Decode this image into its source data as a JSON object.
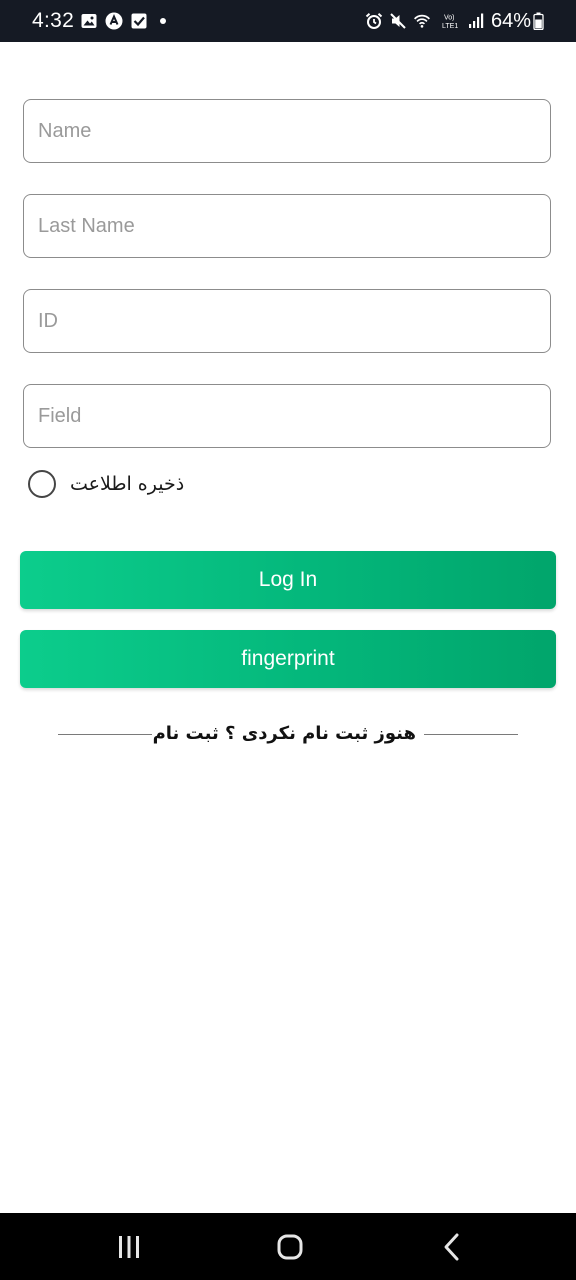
{
  "status_bar": {
    "time": "4:32",
    "battery": "64%",
    "icons": [
      "image-icon",
      "a-badge-icon",
      "checkbox-icon",
      "alarm-icon",
      "mute-icon",
      "wifi-icon",
      "volte-icon",
      "signal-icon",
      "battery-icon"
    ]
  },
  "form": {
    "name_placeholder": "Name",
    "last_name_placeholder": "Last Name",
    "id_placeholder": "ID",
    "field_placeholder": "Field",
    "remember_label": "ذخیره اطلاعت"
  },
  "buttons": {
    "login_label": "Log In",
    "fingerprint_label": "fingerprint"
  },
  "signup": {
    "text": "هنوز ثبت نام نکردی ؟ ثبت نام"
  },
  "colors": {
    "accent_start": "#0ccd8c",
    "accent_end": "#01a56b",
    "status_bar_bg": "#151a24",
    "nav_bar_bg": "#000000"
  },
  "nav_bar": {
    "icons": [
      "recent-apps-icon",
      "home-icon",
      "back-icon"
    ]
  }
}
